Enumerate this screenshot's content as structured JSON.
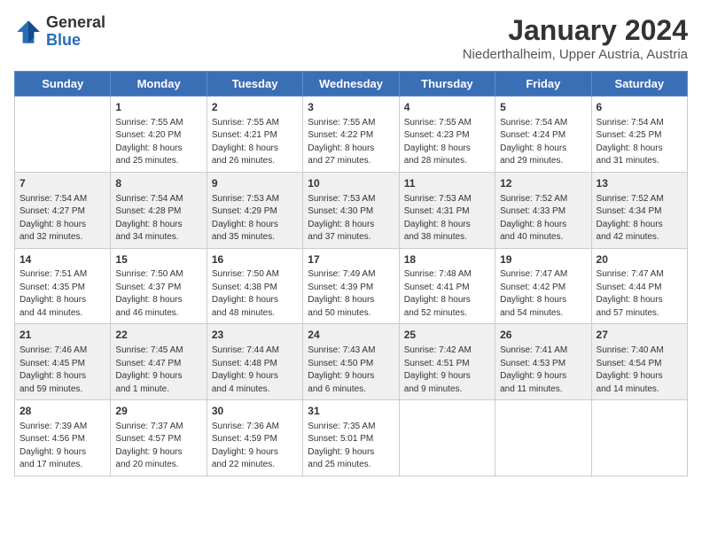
{
  "header": {
    "logo_general": "General",
    "logo_blue": "Blue",
    "main_title": "January 2024",
    "subtitle": "Niederthalheim, Upper Austria, Austria"
  },
  "weekdays": [
    "Sunday",
    "Monday",
    "Tuesday",
    "Wednesday",
    "Thursday",
    "Friday",
    "Saturday"
  ],
  "weeks": [
    [
      {
        "day": "",
        "info": ""
      },
      {
        "day": "1",
        "info": "Sunrise: 7:55 AM\nSunset: 4:20 PM\nDaylight: 8 hours\nand 25 minutes."
      },
      {
        "day": "2",
        "info": "Sunrise: 7:55 AM\nSunset: 4:21 PM\nDaylight: 8 hours\nand 26 minutes."
      },
      {
        "day": "3",
        "info": "Sunrise: 7:55 AM\nSunset: 4:22 PM\nDaylight: 8 hours\nand 27 minutes."
      },
      {
        "day": "4",
        "info": "Sunrise: 7:55 AM\nSunset: 4:23 PM\nDaylight: 8 hours\nand 28 minutes."
      },
      {
        "day": "5",
        "info": "Sunrise: 7:54 AM\nSunset: 4:24 PM\nDaylight: 8 hours\nand 29 minutes."
      },
      {
        "day": "6",
        "info": "Sunrise: 7:54 AM\nSunset: 4:25 PM\nDaylight: 8 hours\nand 31 minutes."
      }
    ],
    [
      {
        "day": "7",
        "info": "Sunrise: 7:54 AM\nSunset: 4:27 PM\nDaylight: 8 hours\nand 32 minutes."
      },
      {
        "day": "8",
        "info": "Sunrise: 7:54 AM\nSunset: 4:28 PM\nDaylight: 8 hours\nand 34 minutes."
      },
      {
        "day": "9",
        "info": "Sunrise: 7:53 AM\nSunset: 4:29 PM\nDaylight: 8 hours\nand 35 minutes."
      },
      {
        "day": "10",
        "info": "Sunrise: 7:53 AM\nSunset: 4:30 PM\nDaylight: 8 hours\nand 37 minutes."
      },
      {
        "day": "11",
        "info": "Sunrise: 7:53 AM\nSunset: 4:31 PM\nDaylight: 8 hours\nand 38 minutes."
      },
      {
        "day": "12",
        "info": "Sunrise: 7:52 AM\nSunset: 4:33 PM\nDaylight: 8 hours\nand 40 minutes."
      },
      {
        "day": "13",
        "info": "Sunrise: 7:52 AM\nSunset: 4:34 PM\nDaylight: 8 hours\nand 42 minutes."
      }
    ],
    [
      {
        "day": "14",
        "info": "Sunrise: 7:51 AM\nSunset: 4:35 PM\nDaylight: 8 hours\nand 44 minutes."
      },
      {
        "day": "15",
        "info": "Sunrise: 7:50 AM\nSunset: 4:37 PM\nDaylight: 8 hours\nand 46 minutes."
      },
      {
        "day": "16",
        "info": "Sunrise: 7:50 AM\nSunset: 4:38 PM\nDaylight: 8 hours\nand 48 minutes."
      },
      {
        "day": "17",
        "info": "Sunrise: 7:49 AM\nSunset: 4:39 PM\nDaylight: 8 hours\nand 50 minutes."
      },
      {
        "day": "18",
        "info": "Sunrise: 7:48 AM\nSunset: 4:41 PM\nDaylight: 8 hours\nand 52 minutes."
      },
      {
        "day": "19",
        "info": "Sunrise: 7:47 AM\nSunset: 4:42 PM\nDaylight: 8 hours\nand 54 minutes."
      },
      {
        "day": "20",
        "info": "Sunrise: 7:47 AM\nSunset: 4:44 PM\nDaylight: 8 hours\nand 57 minutes."
      }
    ],
    [
      {
        "day": "21",
        "info": "Sunrise: 7:46 AM\nSunset: 4:45 PM\nDaylight: 8 hours\nand 59 minutes."
      },
      {
        "day": "22",
        "info": "Sunrise: 7:45 AM\nSunset: 4:47 PM\nDaylight: 9 hours\nand 1 minute."
      },
      {
        "day": "23",
        "info": "Sunrise: 7:44 AM\nSunset: 4:48 PM\nDaylight: 9 hours\nand 4 minutes."
      },
      {
        "day": "24",
        "info": "Sunrise: 7:43 AM\nSunset: 4:50 PM\nDaylight: 9 hours\nand 6 minutes."
      },
      {
        "day": "25",
        "info": "Sunrise: 7:42 AM\nSunset: 4:51 PM\nDaylight: 9 hours\nand 9 minutes."
      },
      {
        "day": "26",
        "info": "Sunrise: 7:41 AM\nSunset: 4:53 PM\nDaylight: 9 hours\nand 11 minutes."
      },
      {
        "day": "27",
        "info": "Sunrise: 7:40 AM\nSunset: 4:54 PM\nDaylight: 9 hours\nand 14 minutes."
      }
    ],
    [
      {
        "day": "28",
        "info": "Sunrise: 7:39 AM\nSunset: 4:56 PM\nDaylight: 9 hours\nand 17 minutes."
      },
      {
        "day": "29",
        "info": "Sunrise: 7:37 AM\nSunset: 4:57 PM\nDaylight: 9 hours\nand 20 minutes."
      },
      {
        "day": "30",
        "info": "Sunrise: 7:36 AM\nSunset: 4:59 PM\nDaylight: 9 hours\nand 22 minutes."
      },
      {
        "day": "31",
        "info": "Sunrise: 7:35 AM\nSunset: 5:01 PM\nDaylight: 9 hours\nand 25 minutes."
      },
      {
        "day": "",
        "info": ""
      },
      {
        "day": "",
        "info": ""
      },
      {
        "day": "",
        "info": ""
      }
    ]
  ]
}
